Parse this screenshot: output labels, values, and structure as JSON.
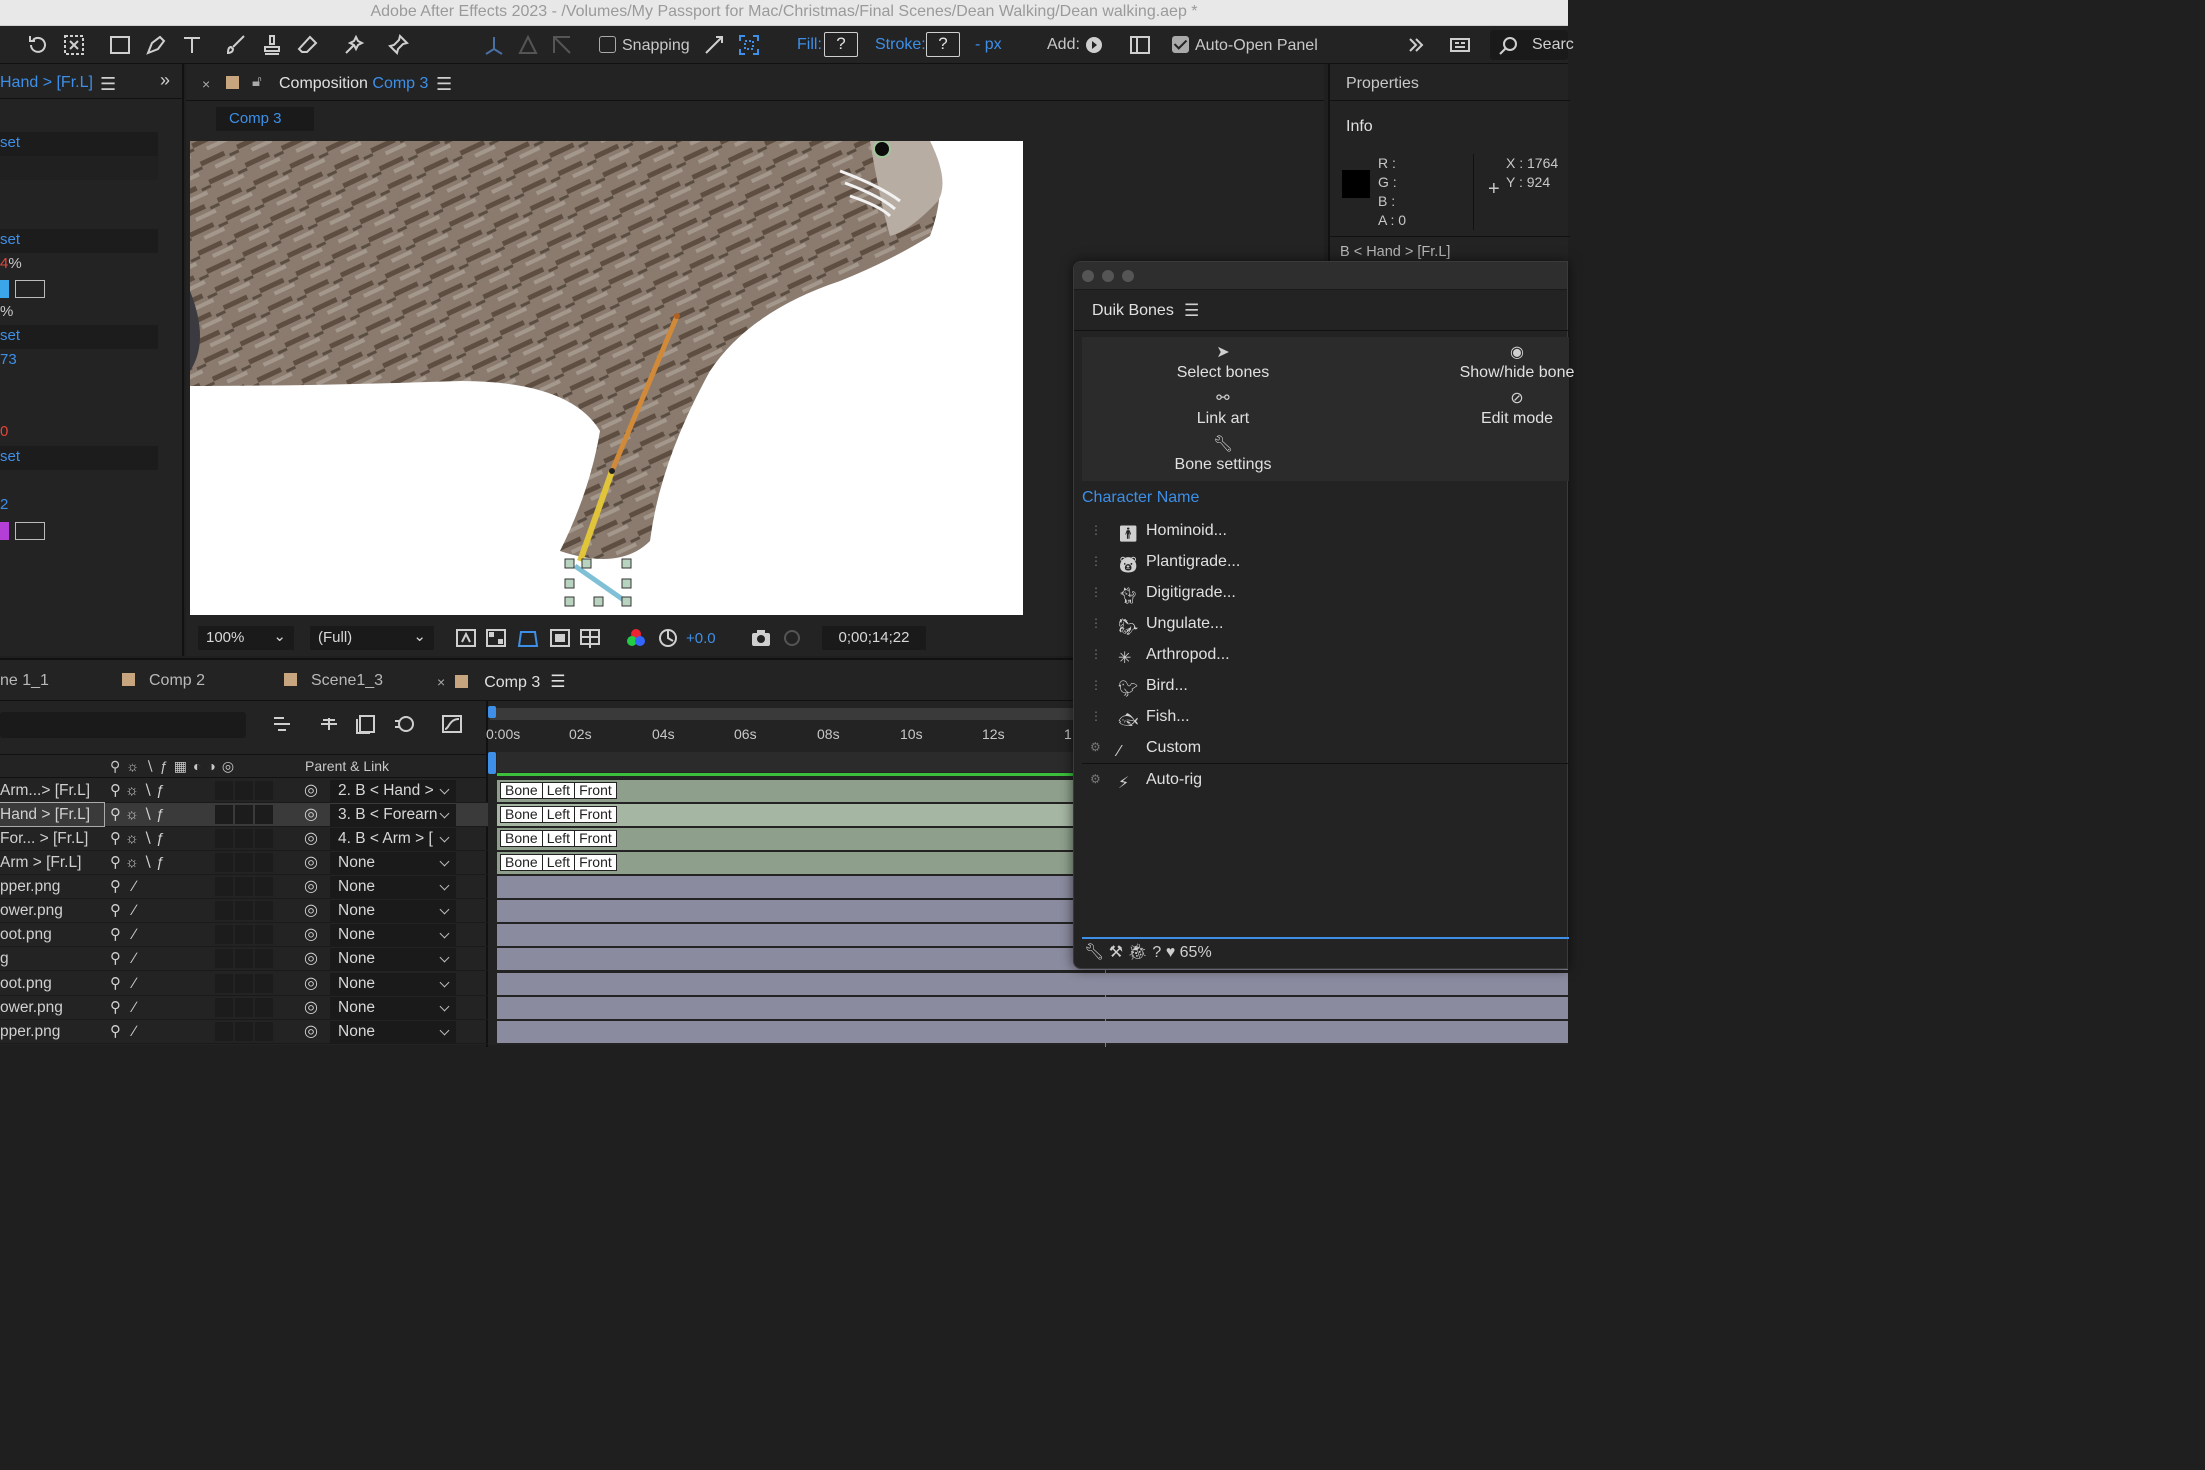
{
  "titlebar": {
    "title": "Adobe After Effects 2023 - /Volumes/My Passport for Mac/Christmas/Final Scenes/Dean Walking/Dean walking.aep *"
  },
  "toolbar": {
    "snapping_label": "Snapping",
    "fill_label": "Fill:",
    "fill_value": "?",
    "stroke_label": "Stroke:",
    "stroke_value": "?",
    "stroke_px": "- px",
    "add_label": "Add:",
    "auto_open_label": "Auto-Open Panel",
    "search_label": "Searc"
  },
  "left_panel": {
    "title": "Hand > [Fr.L]",
    "rows": [
      "set",
      "set",
      "4",
      "%",
      "%",
      "set",
      "73",
      "0",
      "set",
      "2"
    ]
  },
  "composition": {
    "title_prefix": "Composition",
    "comp_name": "Comp 3",
    "tab_label": "Comp 3",
    "zoom": "100%",
    "resolution": "(Full)",
    "exposure": "+0.0",
    "timecode": "0;00;14;22"
  },
  "properties": {
    "title": "Properties",
    "info_title": "Info",
    "r_label": "R :",
    "g_label": "G :",
    "b_label": "B :",
    "a_label": "A :",
    "a_value": "0",
    "x_label": "X : 1764",
    "y_label": "Y : 924",
    "selected_layer": "B < Hand > [Fr.L]"
  },
  "timeline": {
    "tabs": [
      "ne 1_1",
      "Comp 2",
      "Scene1_3",
      "Comp 3"
    ],
    "parent_header": "Parent & Link",
    "ruler": [
      "0:00s",
      "02s",
      "04s",
      "06s",
      "08s",
      "10s",
      "12s",
      "1"
    ],
    "layers": [
      {
        "name": "Arm...> [Fr.L]",
        "parent": "2. B < Hand >",
        "bone": true
      },
      {
        "name": "Hand > [Fr.L]",
        "parent": "3. B < Forearn",
        "bone": true
      },
      {
        "name": "For... > [Fr.L]",
        "parent": "4. B < Arm > [",
        "bone": true
      },
      {
        "name": "Arm > [Fr.L]",
        "parent": "None",
        "bone": true
      },
      {
        "name": "pper.png",
        "parent": "None",
        "bone": false
      },
      {
        "name": "ower.png",
        "parent": "None",
        "bone": false
      },
      {
        "name": "oot.png",
        "parent": "None",
        "bone": false
      },
      {
        "name": "g",
        "parent": "None",
        "bone": false
      },
      {
        "name": "oot.png",
        "parent": "None",
        "bone": false
      },
      {
        "name": "ower.png",
        "parent": "None",
        "bone": false
      },
      {
        "name": "pper.png",
        "parent": "None",
        "bone": false
      }
    ],
    "bone_labels": [
      "Bone",
      "Left",
      "Front"
    ]
  },
  "duik": {
    "title": "Duik Bones",
    "buttons": [
      "Select bones",
      "Show/hide bone",
      "Link art",
      "Edit mode",
      "Bone settings"
    ],
    "character_name_label": "Character Name",
    "characters": [
      "Hominoid...",
      "Plantigrade...",
      "Digitigrade...",
      "Ungulate...",
      "Arthropod...",
      "Bird...",
      "Fish...",
      "Custom",
      "Auto-rig"
    ],
    "footer_percent": "65%"
  },
  "colors": {
    "accent": "#3d8fe8",
    "panel_bg": "#232323",
    "bone_track": "#8ea08c",
    "layer_track": "#8b8ba0"
  }
}
